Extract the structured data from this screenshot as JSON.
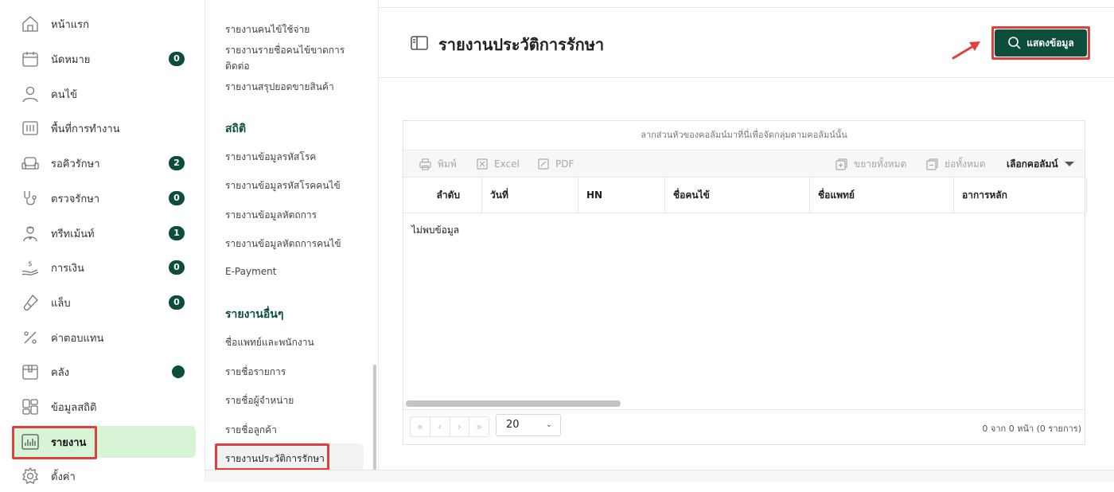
{
  "sidebar": {
    "items": [
      {
        "label": "หน้าแรก",
        "icon": "home-icon"
      },
      {
        "label": "นัดหมาย",
        "icon": "calendar-icon",
        "badge": "0"
      },
      {
        "label": "คนไข้",
        "icon": "user-icon"
      },
      {
        "label": "พื้นที่การทำงาน",
        "icon": "workspace-icon"
      },
      {
        "label": "รอคิวรักษา",
        "icon": "dental-chair-icon",
        "badge": "2"
      },
      {
        "label": "ตรวจรักษา",
        "icon": "stethoscope-icon",
        "badge": "0"
      },
      {
        "label": "ทรีทเม้นท์",
        "icon": "doctor-icon",
        "badge": "1"
      },
      {
        "label": "การเงิน",
        "icon": "money-hand-icon",
        "badge": "0"
      },
      {
        "label": "แล็บ",
        "icon": "test-tube-icon",
        "badge": "0"
      },
      {
        "label": "ค่าตอบแทน",
        "icon": "percent-icon"
      },
      {
        "label": "คลัง",
        "icon": "box-icon"
      },
      {
        "label": "ข้อมูลสถิติ",
        "icon": "grid-icon"
      },
      {
        "label": "รายงาน",
        "icon": "bar-chart-icon"
      },
      {
        "label": "ตั้งค่า",
        "icon": "gear-icon"
      }
    ]
  },
  "submenu": {
    "links_top": [
      "รายงานคนไข้ใช้จ่าย",
      "รายงานรายชื่อคนไข้ขาดการ",
      "ติดต่อ",
      "รายงานสรุปยอดขายสินค้า"
    ],
    "section_stats": "สถิติ",
    "stats_links": [
      "รายงานข้อมูลรหัสโรค",
      "รายงานข้อมูลรหัสโรคคนไข้",
      "รายงานข้อมูลหัตถการ",
      "รายงานข้อมูลหัตถการคนไข้",
      "E-Payment"
    ],
    "section_other": "รายงานอื่นๆ",
    "other_links": [
      "ชื่อแพทย์และพนักงาน",
      "รายชื่อรายการ",
      "รายชื่อผู้จำหน่าย",
      "รายชื่อลูกค้า",
      "รายงานประวัติการรักษา"
    ]
  },
  "page": {
    "title": "รายงานประวัติการรักษา",
    "show_button": "แสดงข้อมูล"
  },
  "grid": {
    "group_hint": "ลากส่วนหัวของคอลัมน์มาที่นี่เพื่อจัดกลุ่มตามคอลัมน์นั้น",
    "toolbar": {
      "print": "พิมพ์",
      "excel": "Excel",
      "pdf": "PDF",
      "expand_all": "ขยายทั้งหมด",
      "collapse_all": "ย่อทั้งหมด",
      "choose_columns": "เลือกคอลัมน์"
    },
    "columns": [
      "ลำดับ",
      "วันที่",
      "HN",
      "ชื่อคนไข้",
      "ชื่อแพทย์",
      "อาการหลัก"
    ],
    "empty_text": "ไม่พบข้อมูล",
    "pager": {
      "first": "«",
      "prev": "‹",
      "next": "›",
      "last": "»"
    },
    "page_size": "20",
    "page_info": "0 จาก 0 หน้า (0 รายการ)"
  },
  "colors": {
    "accent": "#0d4d3c",
    "active_bg": "#d7f5d6",
    "highlight": "#e0403b"
  }
}
